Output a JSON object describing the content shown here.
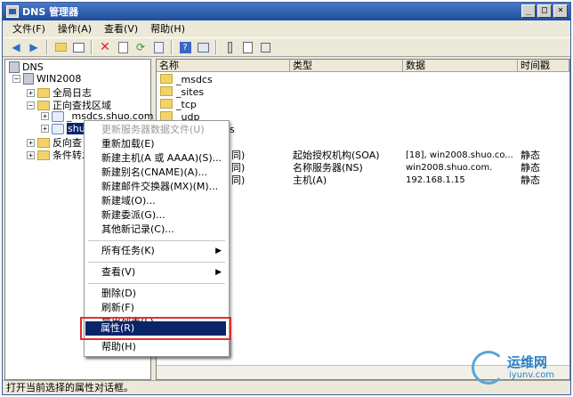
{
  "window": {
    "title": "DNS 管理器",
    "buttons": [
      "_",
      "□",
      "×"
    ]
  },
  "menubar": [
    "文件(F)",
    "操作(A)",
    "查看(V)",
    "帮助(H)"
  ],
  "toolbar": [
    "back-icon",
    "forward-icon",
    "up-folder-icon",
    "show-hide-tree-icon",
    "delete-icon",
    "properties-icon",
    "refresh-icon",
    "export-list-icon",
    "help-icon",
    "console-icon",
    "list-view-icon",
    "detail-view-icon"
  ],
  "tree": {
    "root": "DNS",
    "server": "WIN2008",
    "global_logs": "全局日志",
    "forward_zones": "正向查找区域",
    "msdcs_zone": "_msdcs.shuo.com",
    "shuo_zone": "shuo.com",
    "reverse_zones": "反向查",
    "conditional": "条件转发"
  },
  "list": {
    "headers": [
      "名称",
      "类型",
      "数据",
      "时间戳"
    ],
    "rows": [
      {
        "name": "_msdcs",
        "type": "",
        "data": "",
        "ts": ""
      },
      {
        "name": "_sites",
        "type": "",
        "data": "",
        "ts": ""
      },
      {
        "name": "_tcp",
        "type": "",
        "data": "",
        "ts": ""
      },
      {
        "name": "_udp",
        "type": "",
        "data": "",
        "ts": ""
      },
      {
        "name": "s",
        "type": "",
        "data": "",
        "ts": ""
      },
      {
        "name": "同)",
        "type": "起始授权机构(SOA)",
        "data": "[18], win2008.shuo.co...",
        "ts": "静态"
      },
      {
        "name": "同)",
        "type": "名称服务器(NS)",
        "data": "win2008.shuo.com.",
        "ts": "静态"
      },
      {
        "name": "同)",
        "type": "主机(A)",
        "data": "192.168.1.15",
        "ts": "静态"
      }
    ]
  },
  "context_menu": {
    "items": [
      {
        "label": "更新服务器数据文件(U)",
        "disabled": true
      },
      {
        "label": "重新加载(E)"
      },
      {
        "label": "新建主机(A 或 AAAA)(S)..."
      },
      {
        "label": "新建别名(CNAME)(A)..."
      },
      {
        "label": "新建邮件交换器(MX)(M)..."
      },
      {
        "label": "新建域(O)..."
      },
      {
        "label": "新建委派(G)..."
      },
      {
        "label": "其他新记录(C)..."
      },
      {
        "label": "所有任务(K)",
        "submenu": true
      },
      {
        "label": "查看(V)",
        "submenu": true
      },
      {
        "label": "删除(D)"
      },
      {
        "label": "刷新(F)"
      },
      {
        "label": "导出列表(L)..."
      },
      {
        "label": "属性(R)",
        "selected": true
      },
      {
        "label": "帮助(H)"
      }
    ]
  },
  "status": "打开当前选择的属性对话框。",
  "watermark": {
    "cn": "运维网",
    "url": "iyunv.com"
  }
}
